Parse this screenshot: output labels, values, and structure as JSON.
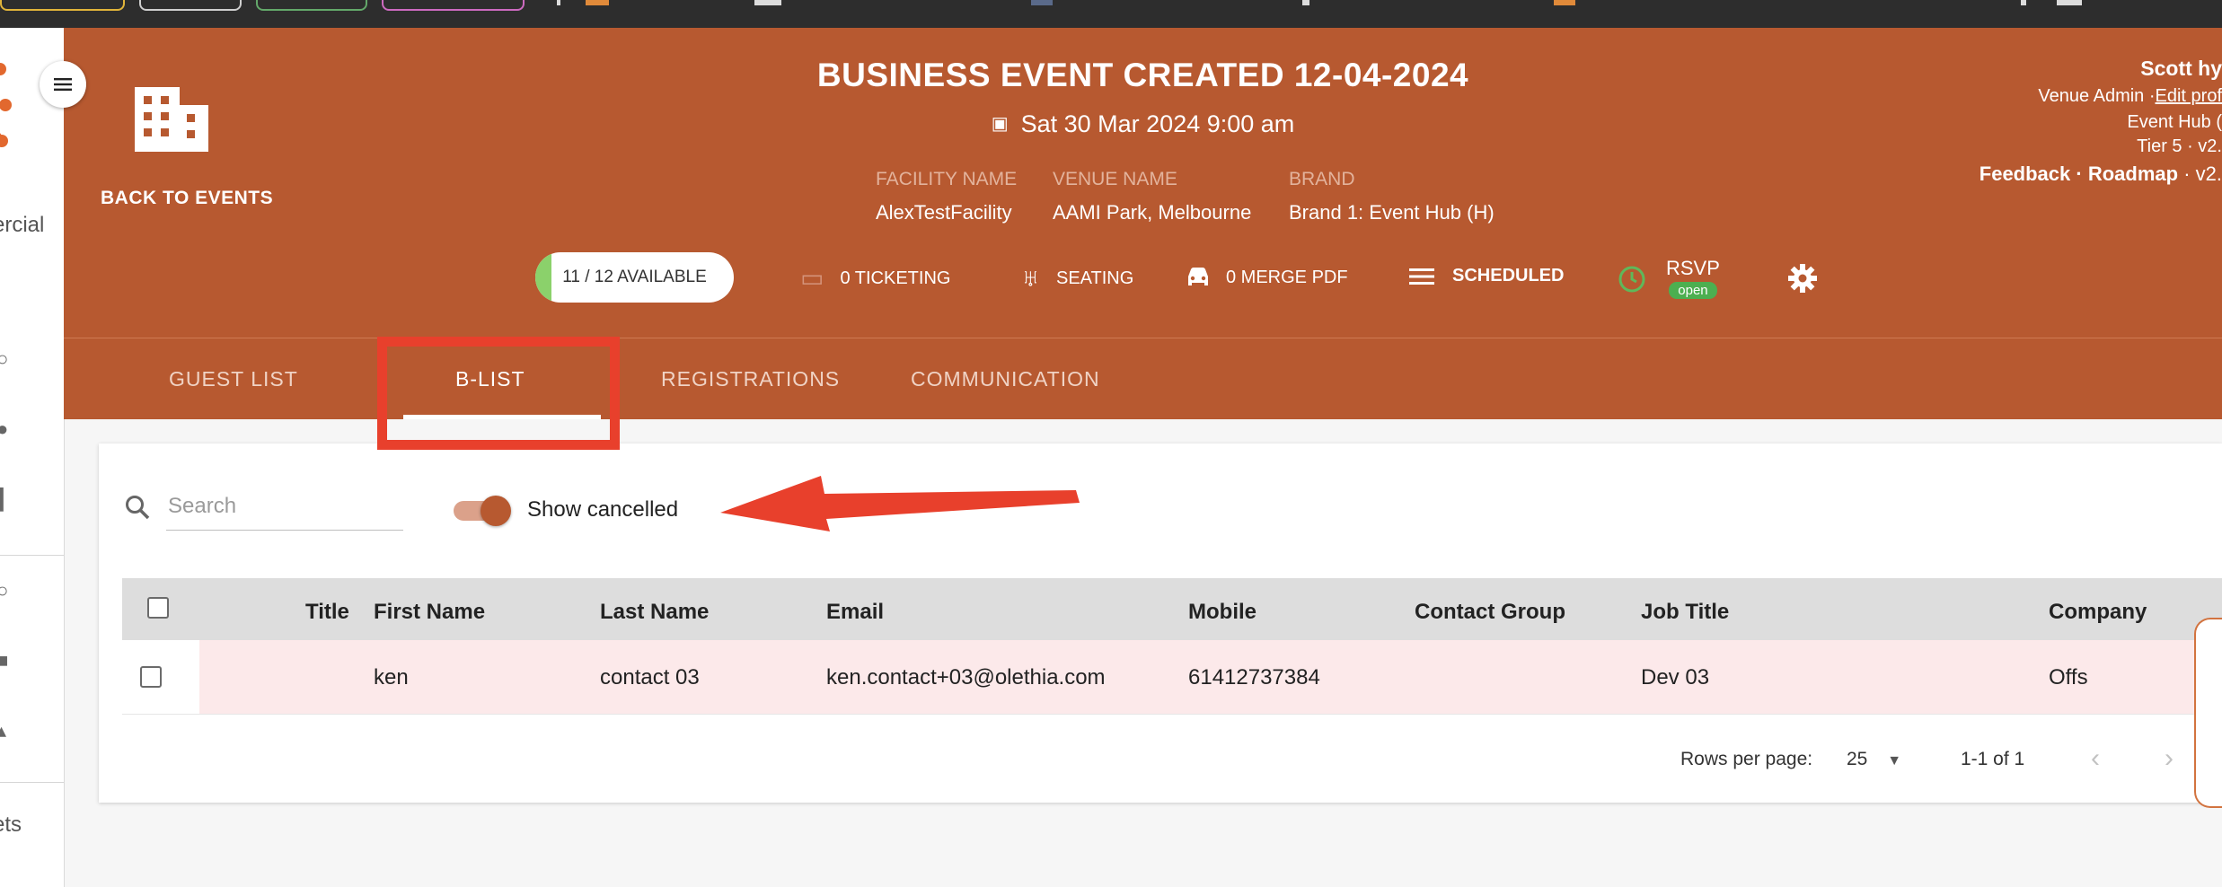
{
  "header": {
    "back_label": "BACK TO EVENTS",
    "title": "BUSINESS EVENT CREATED 12-04-2024",
    "date": "Sat 30 Mar 2024 9:00 am",
    "facility_label": "FACILITY NAME",
    "facility_value": "AlexTestFacility",
    "venue_label": "VENUE NAME",
    "venue_value": "AAMI Park, Melbourne",
    "brand_label": "BRAND",
    "brand_value": "Brand 1: Event Hub (H)"
  },
  "user": {
    "name": "Scott hy",
    "role_line": "Venue Admin ·",
    "edit_link": "Edit prof",
    "hub_line": "Event Hub (",
    "tier_line": "Tier 5 · v2.",
    "feedback": "Feedback",
    "roadmap": "Roadmap",
    "version": "· v2."
  },
  "sidebar": {
    "partial_texts": [
      "ercial",
      "ets"
    ]
  },
  "stats": {
    "available_text": "11 / 12 AVAILABLE",
    "available_fraction": 0.0814,
    "ticketing": "0 TICKETING",
    "seating": "SEATING",
    "merge_pdf": "0 MERGE PDF",
    "scheduled": "SCHEDULED",
    "rsvp": "RSVP",
    "rsvp_status": "open"
  },
  "tabs": [
    {
      "label": "GUEST LIST",
      "active": false
    },
    {
      "label": "B-LIST",
      "active": true
    },
    {
      "label": "REGISTRATIONS",
      "active": false
    },
    {
      "label": "COMMUNICATION",
      "active": false
    }
  ],
  "toolbar": {
    "search_placeholder": "Search",
    "show_cancelled_label": "Show cancelled",
    "show_cancelled_on": true
  },
  "table": {
    "columns": [
      "Title",
      "First Name",
      "Last Name",
      "Email",
      "Mobile",
      "Contact Group",
      "Job Title",
      "Company"
    ],
    "rows": [
      {
        "title": "",
        "first_name": "ken",
        "last_name": "contact 03",
        "email": "ken.contact+03@olethia.com",
        "mobile": "61412737384",
        "contact_group": "",
        "job_title": "Dev 03",
        "company": "Offs"
      }
    ]
  },
  "pagination": {
    "rows_per_page_label": "Rows per page:",
    "rows_per_page": "25",
    "range": "1-1 of 1"
  },
  "colors": {
    "brand": "#b75930",
    "annotation_red": "#e8402c",
    "available_green": "#8bd16b",
    "rsvp_green": "#4caf50"
  }
}
